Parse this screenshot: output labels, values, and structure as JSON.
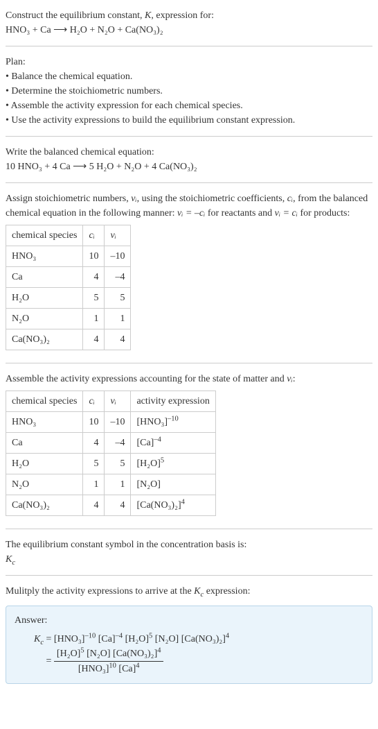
{
  "header": {
    "line1": "Construct the equilibrium constant, ",
    "Kital": "K",
    "line1b": ", expression for:",
    "eq": "HNO₃ + Ca ⟶ H₂O + N₂O + Ca(NO₃)₂"
  },
  "plan": {
    "title": "Plan:",
    "items": [
      "• Balance the chemical equation.",
      "• Determine the stoichiometric numbers.",
      "• Assemble the activity expression for each chemical species.",
      "• Use the activity expressions to build the equilibrium constant expression."
    ]
  },
  "balanced": {
    "title": "Write the balanced chemical equation:",
    "eq": "10 HNO₃ + 4 Ca ⟶ 5 H₂O + N₂O + 4 Ca(NO₃)₂"
  },
  "stoich": {
    "intro_a": "Assign stoichiometric numbers, ",
    "nu": "νᵢ",
    "intro_b": ", using the stoichiometric coefficients, ",
    "ci": "cᵢ",
    "intro_c": ", from the balanced chemical equation in the following manner: ",
    "rel1": "νᵢ = –cᵢ",
    "intro_d": " for reactants and ",
    "rel2": "νᵢ = cᵢ",
    "intro_e": " for products:",
    "headers": {
      "species": "chemical species",
      "ci": "cᵢ",
      "nu": "νᵢ"
    },
    "rows": [
      {
        "species": "HNO₃",
        "ci": "10",
        "nu": "–10"
      },
      {
        "species": "Ca",
        "ci": "4",
        "nu": "–4"
      },
      {
        "species": "H₂O",
        "ci": "5",
        "nu": "5"
      },
      {
        "species": "N₂O",
        "ci": "1",
        "nu": "1"
      },
      {
        "species": "Ca(NO₃)₂",
        "ci": "4",
        "nu": "4"
      }
    ]
  },
  "activity": {
    "intro_a": "Assemble the activity expressions accounting for the state of matter and ",
    "nu": "νᵢ",
    "intro_b": ":",
    "headers": {
      "species": "chemical species",
      "ci": "cᵢ",
      "nu": "νᵢ",
      "act": "activity expression"
    },
    "rows": [
      {
        "species": "HNO₃",
        "ci": "10",
        "nu": "–10",
        "act_base": "[HNO₃]",
        "act_exp": "–10"
      },
      {
        "species": "Ca",
        "ci": "4",
        "nu": "–4",
        "act_base": "[Ca]",
        "act_exp": "–4"
      },
      {
        "species": "H₂O",
        "ci": "5",
        "nu": "5",
        "act_base": "[H₂O]",
        "act_exp": "5"
      },
      {
        "species": "N₂O",
        "ci": "1",
        "nu": "1",
        "act_base": "[N₂O]",
        "act_exp": ""
      },
      {
        "species": "Ca(NO₃)₂",
        "ci": "4",
        "nu": "4",
        "act_base": "[Ca(NO₃)₂]",
        "act_exp": "4"
      }
    ]
  },
  "symbol": {
    "line": "The equilibrium constant symbol in the concentration basis is:",
    "kc_base": "K",
    "kc_sub": "c"
  },
  "multiply": {
    "line_a": "Mulitply the activity expressions to arrive at the ",
    "kc_base": "K",
    "kc_sub": "c",
    "line_b": " expression:"
  },
  "answer": {
    "label": "Answer:",
    "lhs_base": "K",
    "lhs_sub": "c",
    "eq": " = ",
    "flat": {
      "t1b": "[HNO₃]",
      "t1e": "–10",
      "t2b": "[Ca]",
      "t2e": "–4",
      "t3b": "[H₂O]",
      "t3e": "5",
      "t4b": "[N₂O]",
      "t5b": "[Ca(NO₃)₂]",
      "t5e": "4"
    },
    "eq2": "= ",
    "frac": {
      "n1b": "[H₂O]",
      "n1e": "5",
      "n2b": "[N₂O]",
      "n3b": "[Ca(NO₃)₂]",
      "n3e": "4",
      "d1b": "[HNO₃]",
      "d1e": "10",
      "d2b": "[Ca]",
      "d2e": "4"
    }
  },
  "chart_data": {
    "type": "table",
    "tables": [
      {
        "name": "stoichiometric_numbers",
        "columns": [
          "chemical species",
          "c_i",
          "nu_i"
        ],
        "rows": [
          [
            "HNO3",
            10,
            -10
          ],
          [
            "Ca",
            4,
            -4
          ],
          [
            "H2O",
            5,
            5
          ],
          [
            "N2O",
            1,
            1
          ],
          [
            "Ca(NO3)2",
            4,
            4
          ]
        ]
      },
      {
        "name": "activity_expressions",
        "columns": [
          "chemical species",
          "c_i",
          "nu_i",
          "activity expression"
        ],
        "rows": [
          [
            "HNO3",
            10,
            -10,
            "[HNO3]^-10"
          ],
          [
            "Ca",
            4,
            -4,
            "[Ca]^-4"
          ],
          [
            "H2O",
            5,
            5,
            "[H2O]^5"
          ],
          [
            "N2O",
            1,
            1,
            "[N2O]"
          ],
          [
            "Ca(NO3)2",
            4,
            4,
            "[Ca(NO3)2]^4"
          ]
        ]
      }
    ]
  }
}
